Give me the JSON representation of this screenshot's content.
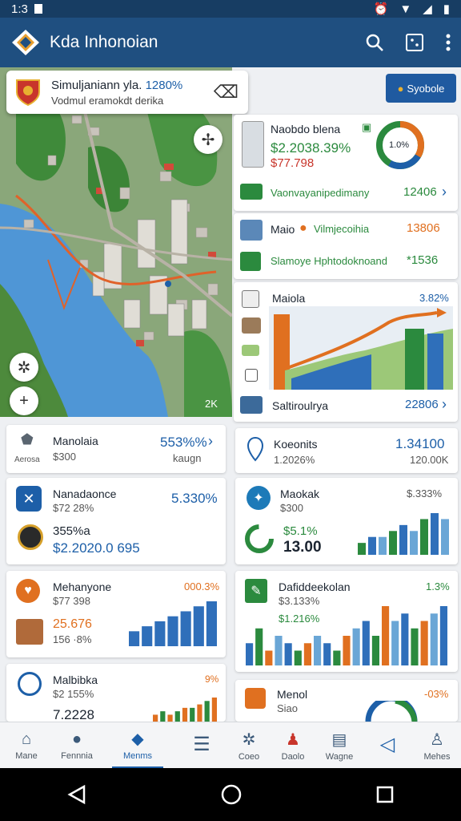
{
  "status": {
    "time": "1:3",
    "icons": [
      "alarm-icon",
      "wifi-icon",
      "battery-icon"
    ]
  },
  "appbar": {
    "title": "Kda Inhonoian"
  },
  "map": {
    "search_line1": "Simuljaniann yla. ",
    "search_pct": "1280%",
    "search_line2": "Vodmul eramokdt derika",
    "compass_label": "2K"
  },
  "schedule_button": {
    "label": "Syobole"
  },
  "right_panel": {
    "summary": {
      "title": "Naobdo blena",
      "value1": "$2.2038.39%",
      "value2": "$77.798",
      "donut_label": "1.0%"
    },
    "row1": {
      "label": "Vaonvayanipedimany",
      "value": "12406"
    },
    "row2": {
      "title": "Maio",
      "label": "Vilmjecoihia",
      "value": "13806"
    },
    "row3": {
      "label": "Slamoye Hphtodoknoand",
      "value": "*1536"
    },
    "chart_card": {
      "title": "Maiola",
      "pct": "3.82%"
    },
    "row4": {
      "label": "Saltiroulrya",
      "value": "22806"
    }
  },
  "left_stats": [
    {
      "title": "Manolaia",
      "sub": "$300",
      "icon_label": "Aerosa",
      "value": "553%%",
      "value_sub": "kaugn"
    },
    {
      "title": "Nanadaonce",
      "sub": "$72 28%",
      "value": "5.330%",
      "line2_pct": "355%a",
      "line2_val": "$2.2020.0 695"
    },
    {
      "title": "Mehanyone",
      "sub": "$77 398",
      "value": "000.3%",
      "v2": "25.676",
      "v3": "156 ·8%"
    },
    {
      "title": "Malbibka",
      "sub": "$2 155%",
      "value": "9%",
      "v2": "7.2228"
    }
  ],
  "right_stats": [
    {
      "title": "Koeonits",
      "sub": "1.2026%",
      "value": "1.34100",
      "value_sub": "120.00K"
    },
    {
      "title": "Maokak",
      "sub": "$300",
      "value": "$.333%",
      "pct": "$5.1%",
      "big": "13.00"
    },
    {
      "title": "Dafiddeekolan",
      "sub": "$3.133%",
      "value": "1.3%",
      "pct": "$1.216%"
    },
    {
      "title": "Menol",
      "sub": "Siao",
      "value": "-03%"
    }
  ],
  "nav": [
    {
      "label": "Mane",
      "icon": "home-icon"
    },
    {
      "label": "Fennnia",
      "icon": "chat-icon"
    },
    {
      "label": "Menms",
      "icon": "bookmark-icon"
    },
    {
      "label": "",
      "icon": "list-icon"
    },
    {
      "label": "Coeo",
      "icon": "settings-icon"
    },
    {
      "label": "Daolo",
      "icon": "map-icon"
    },
    {
      "label": "Wagne",
      "icon": "newspaper-icon"
    },
    {
      "label": "",
      "icon": "send-icon"
    },
    {
      "label": "Mehes",
      "icon": "person-icon"
    }
  ],
  "colors": {
    "primary": "#1f4f80",
    "accent": "#1d5fa8",
    "green": "#2b8a3e",
    "orange": "#e07020"
  },
  "chart_data": [
    {
      "type": "bar",
      "categories": [
        "a",
        "b",
        "c",
        "d",
        "e",
        "f",
        "g"
      ],
      "values": [
        3,
        4,
        5,
        6,
        7,
        8,
        9
      ],
      "title": "",
      "xlabel": "",
      "ylabel": ""
    },
    {
      "type": "bar",
      "categories": [
        "a",
        "b",
        "c",
        "d",
        "e",
        "f",
        "g",
        "h",
        "i"
      ],
      "values": [
        2,
        3,
        3,
        4,
        5,
        4,
        6,
        7,
        6
      ],
      "title": "",
      "xlabel": "",
      "ylabel": ""
    },
    {
      "type": "bar",
      "categories": [
        "a",
        "b",
        "c",
        "d",
        "e",
        "f",
        "g",
        "h",
        "i",
        "j",
        "k",
        "l",
        "m",
        "n",
        "o",
        "p",
        "q",
        "r",
        "s",
        "t",
        "u"
      ],
      "values": [
        3,
        5,
        2,
        4,
        3,
        2,
        3,
        4,
        3,
        2,
        4,
        5,
        6,
        4,
        8,
        6,
        7,
        5,
        6,
        7,
        8
      ],
      "title": "",
      "xlabel": "",
      "ylabel": ""
    },
    {
      "type": "bar",
      "categories": [
        "a",
        "b",
        "c",
        "d",
        "e",
        "f",
        "g",
        "h",
        "i"
      ],
      "values": [
        2,
        3,
        2,
        3,
        4,
        4,
        5,
        6,
        7
      ],
      "title": "",
      "xlabel": "",
      "ylabel": ""
    }
  ]
}
